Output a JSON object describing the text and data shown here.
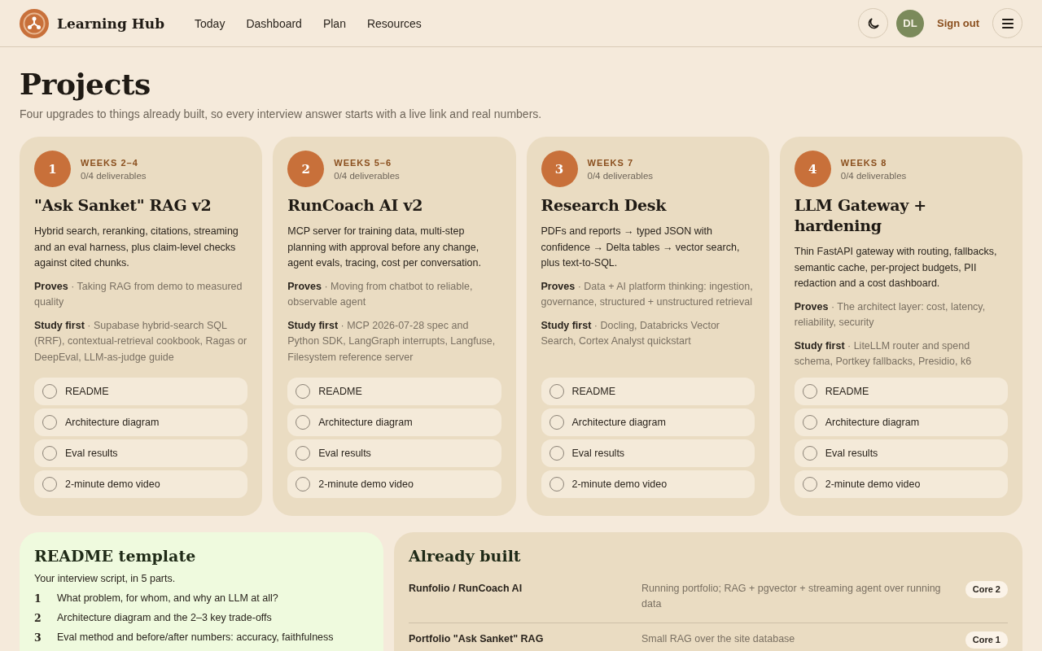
{
  "header": {
    "brand": "Learning Hub",
    "nav": [
      {
        "label": "Today",
        "selected": false
      },
      {
        "label": "Dashboard",
        "selected": false
      },
      {
        "label": "Plan",
        "selected": false
      },
      {
        "label": "Resources",
        "selected": false
      }
    ],
    "avatar": "DL",
    "sign_out": "Sign out"
  },
  "page": {
    "title": "Projects",
    "subtitle": "Four upgrades to things already built, so every interview answer starts with a live link and real numbers."
  },
  "projects": [
    {
      "number": "1",
      "weeks": "WEEKS 2–4",
      "progress": "0/4 deliverables",
      "title": "\"Ask Sanket\" RAG v2",
      "description": "Hybrid search, reranking, citations, streaming and an eval harness, plus claim-level checks against cited chunks.",
      "proves": "**Proves** · Taking RAG from demo to measured quality",
      "study": "**Study first** · Supabase hybrid-search SQL (RRF), contextual-retrieval cookbook, Ragas or DeepEval, LLM-as-judge guide",
      "deliverables": [
        {
          "label": "README",
          "checked": false
        },
        {
          "label": "Architecture diagram",
          "checked": false
        },
        {
          "label": "Eval results",
          "checked": false
        },
        {
          "label": "2-minute demo video",
          "checked": false
        }
      ]
    },
    {
      "number": "2",
      "weeks": "WEEKS 5–6",
      "progress": "0/4 deliverables",
      "title": "RunCoach AI v2",
      "description": "MCP server for training data, multi-step planning with approval before any change, agent evals, tracing, cost per conversation.",
      "proves": "**Proves** · Moving from chatbot to reliable, observable agent",
      "study": "**Study first** · MCP 2026-07-28 spec and Python SDK, LangGraph interrupts, Langfuse, Filesystem reference server",
      "deliverables": [
        {
          "label": "README",
          "checked": false
        },
        {
          "label": "Architecture diagram",
          "checked": false
        },
        {
          "label": "Eval results",
          "checked": false
        },
        {
          "label": "2-minute demo video",
          "checked": false
        }
      ]
    },
    {
      "number": "3",
      "weeks": "WEEKS 7",
      "progress": "0/4 deliverables",
      "title": "Research Desk",
      "description": "PDFs and reports → typed JSON with confidence → Delta tables → vector search, plus text-to-SQL.",
      "proves": "**Proves** · Data + AI platform thinking: ingestion, governance, structured + unstructured retrieval",
      "study": "**Study first** · Docling, Databricks Vector Search, Cortex Analyst quickstart",
      "deliverables": [
        {
          "label": "README",
          "checked": false
        },
        {
          "label": "Architecture diagram",
          "checked": false
        },
        {
          "label": "Eval results",
          "checked": false
        },
        {
          "label": "2-minute demo video",
          "checked": false
        }
      ]
    },
    {
      "number": "4",
      "weeks": "WEEKS 8",
      "progress": "0/4 deliverables",
      "title": "LLM Gateway + hardening",
      "description": "Thin FastAPI gateway with routing, fallbacks, semantic cache, per-project budgets, PII redaction and a cost dashboard.",
      "proves": "**Proves** · The architect layer: cost, latency, reliability, security",
      "study": "**Study first** · LiteLLM router and spend schema, Portkey fallbacks, Presidio, k6",
      "deliverables": [
        {
          "label": "README",
          "checked": false
        },
        {
          "label": "Architecture diagram",
          "checked": false
        },
        {
          "label": "Eval results",
          "checked": false
        },
        {
          "label": "2-minute demo video",
          "checked": false
        }
      ]
    }
  ],
  "readme_template": {
    "title": "README template",
    "intro": "Your interview script, in 5 parts.",
    "steps": [
      {
        "number": "1",
        "text": "What problem, for whom, and why an LLM at all?"
      },
      {
        "number": "2",
        "text": "Architecture diagram and the 2–3 key trade-offs"
      },
      {
        "number": "3",
        "text": "Eval method and before/after numbers: accuracy, faithfulness"
      }
    ]
  },
  "already_built": {
    "title": "Already built",
    "rows": [
      {
        "name": "Runfolio / RunCoach AI",
        "description": "Running portfolio; RAG + pgvector + streaming agent over running data",
        "badge": "Core 2"
      },
      {
        "name": "Portfolio \"Ask Sanket\" RAG",
        "description": "Small RAG over the site database",
        "badge": "Core 1"
      }
    ]
  }
}
